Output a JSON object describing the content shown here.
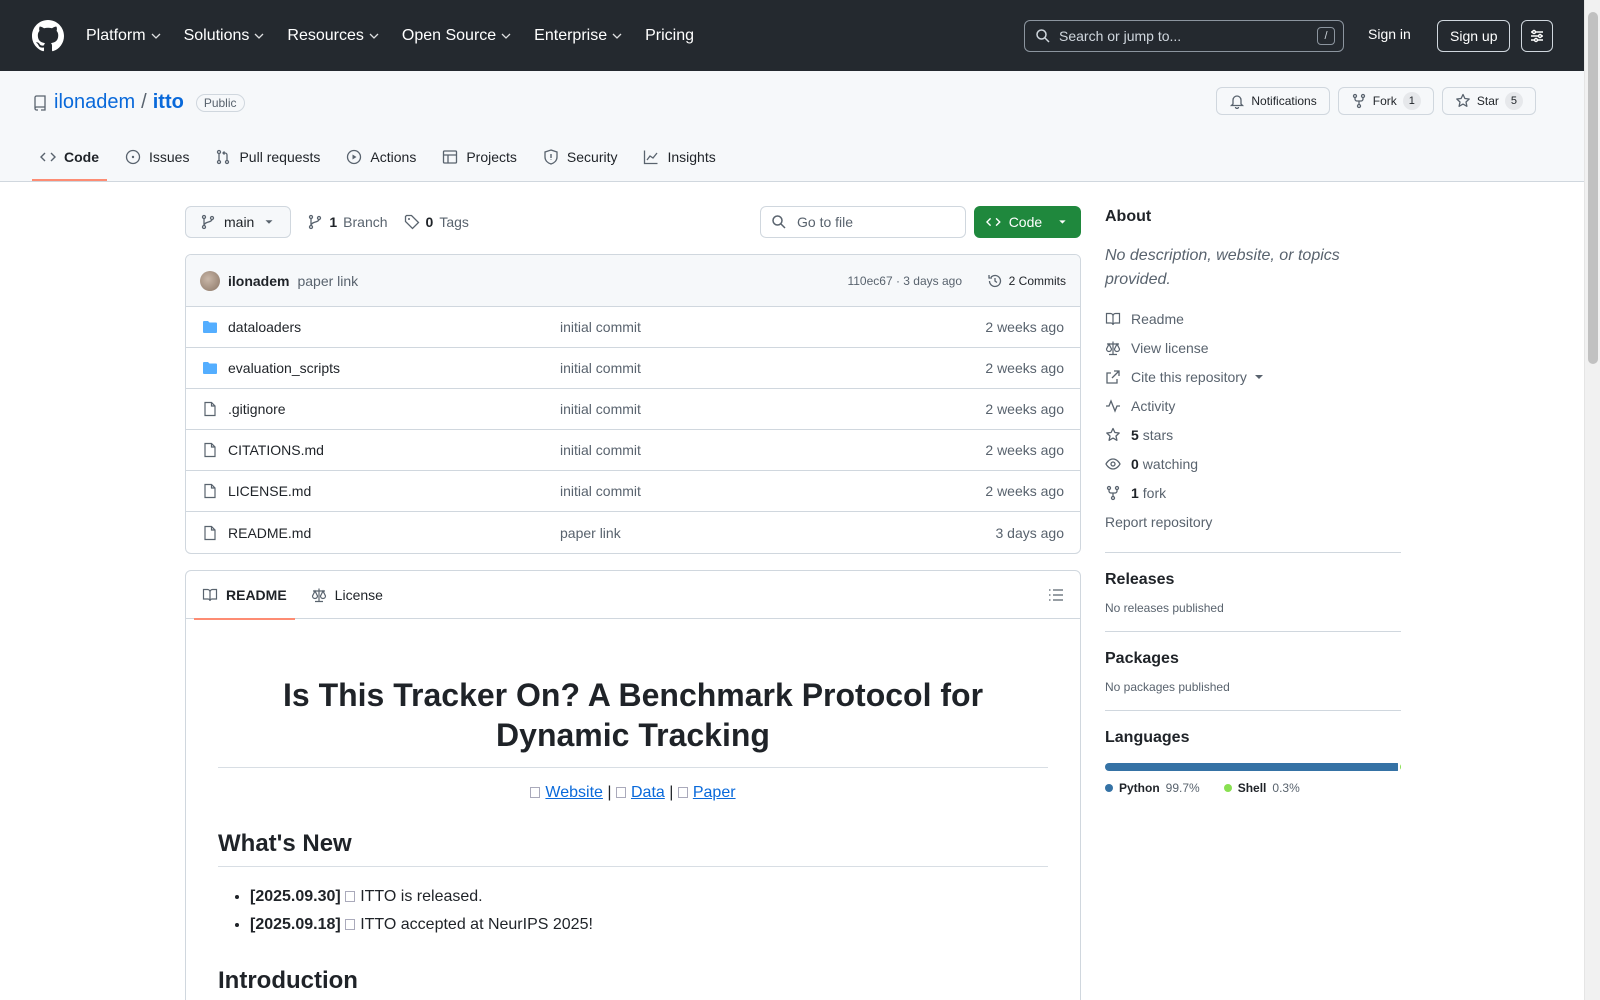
{
  "header": {
    "nav": [
      "Platform",
      "Solutions",
      "Resources",
      "Open Source",
      "Enterprise",
      "Pricing"
    ],
    "search_placeholder": "Search or jump to...",
    "search_key": "/",
    "sign_in": "Sign in",
    "sign_up": "Sign up"
  },
  "repo": {
    "owner": "ilonadem",
    "separator": "/",
    "name": "itto",
    "visibility": "Public",
    "notifications_label": "Notifications",
    "fork_label": "Fork",
    "fork_count": "1",
    "star_label": "Star",
    "star_count": "5",
    "tabs": [
      "Code",
      "Issues",
      "Pull requests",
      "Actions",
      "Projects",
      "Security",
      "Insights"
    ]
  },
  "file_nav": {
    "branch": "main",
    "branch_count": "1",
    "branch_label": "Branch",
    "tag_count": "0",
    "tag_label": "Tags",
    "goto_placeholder": "Go to file",
    "code_button": "Code"
  },
  "commit": {
    "author": "ilonadem",
    "message": "paper link",
    "hash_time": "110ec67 · 3 days ago",
    "commits": "2 Commits"
  },
  "files": [
    {
      "name": "dataloaders",
      "type": "folder",
      "message": "initial commit",
      "date": "2 weeks ago"
    },
    {
      "name": "evaluation_scripts",
      "type": "folder",
      "message": "initial commit",
      "date": "2 weeks ago"
    },
    {
      "name": ".gitignore",
      "type": "file",
      "message": "initial commit",
      "date": "2 weeks ago"
    },
    {
      "name": "CITATIONS.md",
      "type": "file",
      "message": "initial commit",
      "date": "2 weeks ago"
    },
    {
      "name": "LICENSE.md",
      "type": "file",
      "message": "initial commit",
      "date": "2 weeks ago"
    },
    {
      "name": "README.md",
      "type": "file",
      "message": "paper link",
      "date": "3 days ago"
    }
  ],
  "readme": {
    "tab_readme": "README",
    "tab_license": "License",
    "title": "Is This Tracker On? A Benchmark Protocol for Dynamic Tracking",
    "links": [
      "Website",
      "Data",
      "Paper"
    ],
    "link_sep": "|",
    "whats_new_heading": "What's New",
    "news": [
      {
        "date": "[2025.09.30]",
        "text": "ITTO is released."
      },
      {
        "date": "[2025.09.18]",
        "text": "ITTO accepted at NeurIPS 2025!"
      }
    ],
    "intro_heading": "Introduction"
  },
  "about": {
    "heading": "About",
    "description": "No description, website, or topics provided.",
    "readme": "Readme",
    "license": "View license",
    "cite": "Cite this repository",
    "activity": "Activity",
    "stars_count": "5",
    "stars_label": "stars",
    "watching_count": "0",
    "watching_label": "watching",
    "fork_count": "1",
    "fork_label": "fork",
    "report": "Report repository"
  },
  "releases": {
    "heading": "Releases",
    "text": "No releases published"
  },
  "packages": {
    "heading": "Packages",
    "text": "No packages published"
  },
  "languages": {
    "heading": "Languages",
    "items": [
      {
        "name": "Python",
        "percent": "99.7%",
        "value": 99.7,
        "color": "#3572A5"
      },
      {
        "name": "Shell",
        "percent": "0.3%",
        "value": 0.3,
        "color": "#89e051"
      }
    ]
  }
}
